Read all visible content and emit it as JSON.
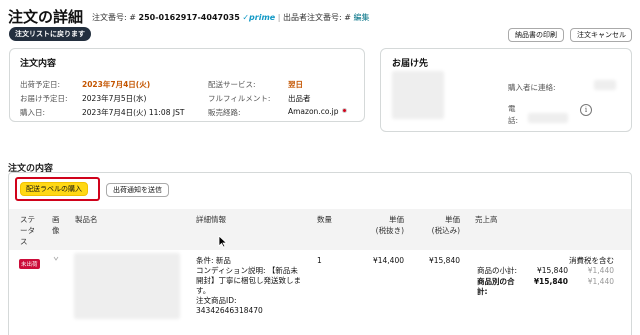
{
  "header": {
    "title": "注文の詳細",
    "order_number_label": "注文番号: #",
    "order_number": "250-0162917-4047035",
    "prime": "✓prime",
    "separator": "|",
    "seller_order_label": "出品者注文番号: #",
    "edit_link": "編集"
  },
  "toolbar": {
    "back_label": "注文リストに戻ります",
    "print_label": "納品書の印刷",
    "cancel_label": "注文キャンセル"
  },
  "order_panel": {
    "title": "注文内容",
    "ship_by_label": "出荷予定日:",
    "ship_by_value": "2023年7月4日(火)",
    "deliver_by_label": "お届け予定日:",
    "deliver_by_value": "2023年7月5日(水)",
    "purchase_label": "購入日:",
    "purchase_value": "2023年7月4日(火) 11:08 JST",
    "service_label": "配送サービス:",
    "service_value": "翌日",
    "fulfillment_label": "フルフィルメント:",
    "fulfillment_value": "出品者",
    "channel_label": "販売経路:",
    "channel_value": "Amazon.co.jp"
  },
  "shipto_panel": {
    "title": "お届け先",
    "contact_label": "購入者に連絡:",
    "phone_label_1": "電",
    "phone_label_2": "話:",
    "info_icon_glyph": "i"
  },
  "contents": {
    "title": "注文の内容",
    "buy_label_button": "配送ラベルの購入",
    "ship_notice_button": "出荷通知を送信"
  },
  "table": {
    "headers": {
      "status_1": "ステ",
      "status_2": "ータ",
      "status_3": "ス",
      "image_1": "画",
      "image_2": "像",
      "product": "製品名",
      "details": "詳細情報",
      "qty": "数量",
      "unit_excl_1": "単価",
      "unit_excl_2": "(税抜き)",
      "unit_incl_1": "単価",
      "unit_incl_2": "(税込み)",
      "proceeds": "売上高"
    },
    "row": {
      "status_badge": "未出荷",
      "details_1": "条件: 新品",
      "details_2": "コンディション説明: 【新品未",
      "details_3": "開封】丁寧に梱包し発送致しま",
      "details_4": "す。",
      "details_5": "注文商品ID:",
      "details_6": "34342646318470",
      "qty": "1",
      "price_excl": "¥14,400",
      "price_incl": "¥15,840",
      "tax_note": "消費税を含む",
      "subtotal_label": "商品の小計:",
      "subtotal_value": "¥15,840",
      "subtotal_tax": "¥1,440",
      "total_label_1": "商品別の合",
      "total_label_2": "計:",
      "total_value": "¥15,840",
      "total_tax": "¥1,440"
    }
  },
  "colors": {
    "accent_orange": "#c45500",
    "button_yellow": "#ffd814",
    "highlight_red": "#d0021b",
    "dark_button": "#232f3e",
    "link_teal": "#007185"
  }
}
